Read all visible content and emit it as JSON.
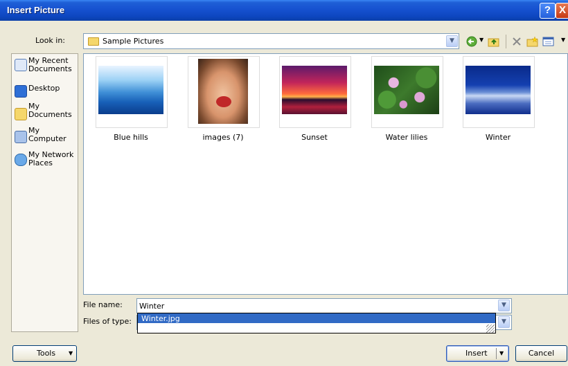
{
  "window": {
    "title": "Insert Picture"
  },
  "titlebar": {
    "help_label": "?",
    "close_label": "X"
  },
  "lookin": {
    "label": "Look in:",
    "value": "Sample Pictures"
  },
  "places": [
    {
      "label": "My Recent Documents",
      "icon": "recent-documents-icon"
    },
    {
      "label": "Desktop",
      "icon": "desktop-icon"
    },
    {
      "label": "My Documents",
      "icon": "my-documents-icon"
    },
    {
      "label": "My Computer",
      "icon": "my-computer-icon"
    },
    {
      "label": "My Network Places",
      "icon": "network-places-icon"
    }
  ],
  "files": [
    {
      "name": "Blue hills"
    },
    {
      "name": "images (7)"
    },
    {
      "name": "Sunset"
    },
    {
      "name": "Water lilies"
    },
    {
      "name": "Winter"
    }
  ],
  "filename": {
    "label": "File name:",
    "value": "Winter",
    "suggestion": "Winter.jpg"
  },
  "filetype": {
    "label": "Files of type:"
  },
  "buttons": {
    "tools": "Tools",
    "insert": "Insert",
    "cancel": "Cancel"
  }
}
